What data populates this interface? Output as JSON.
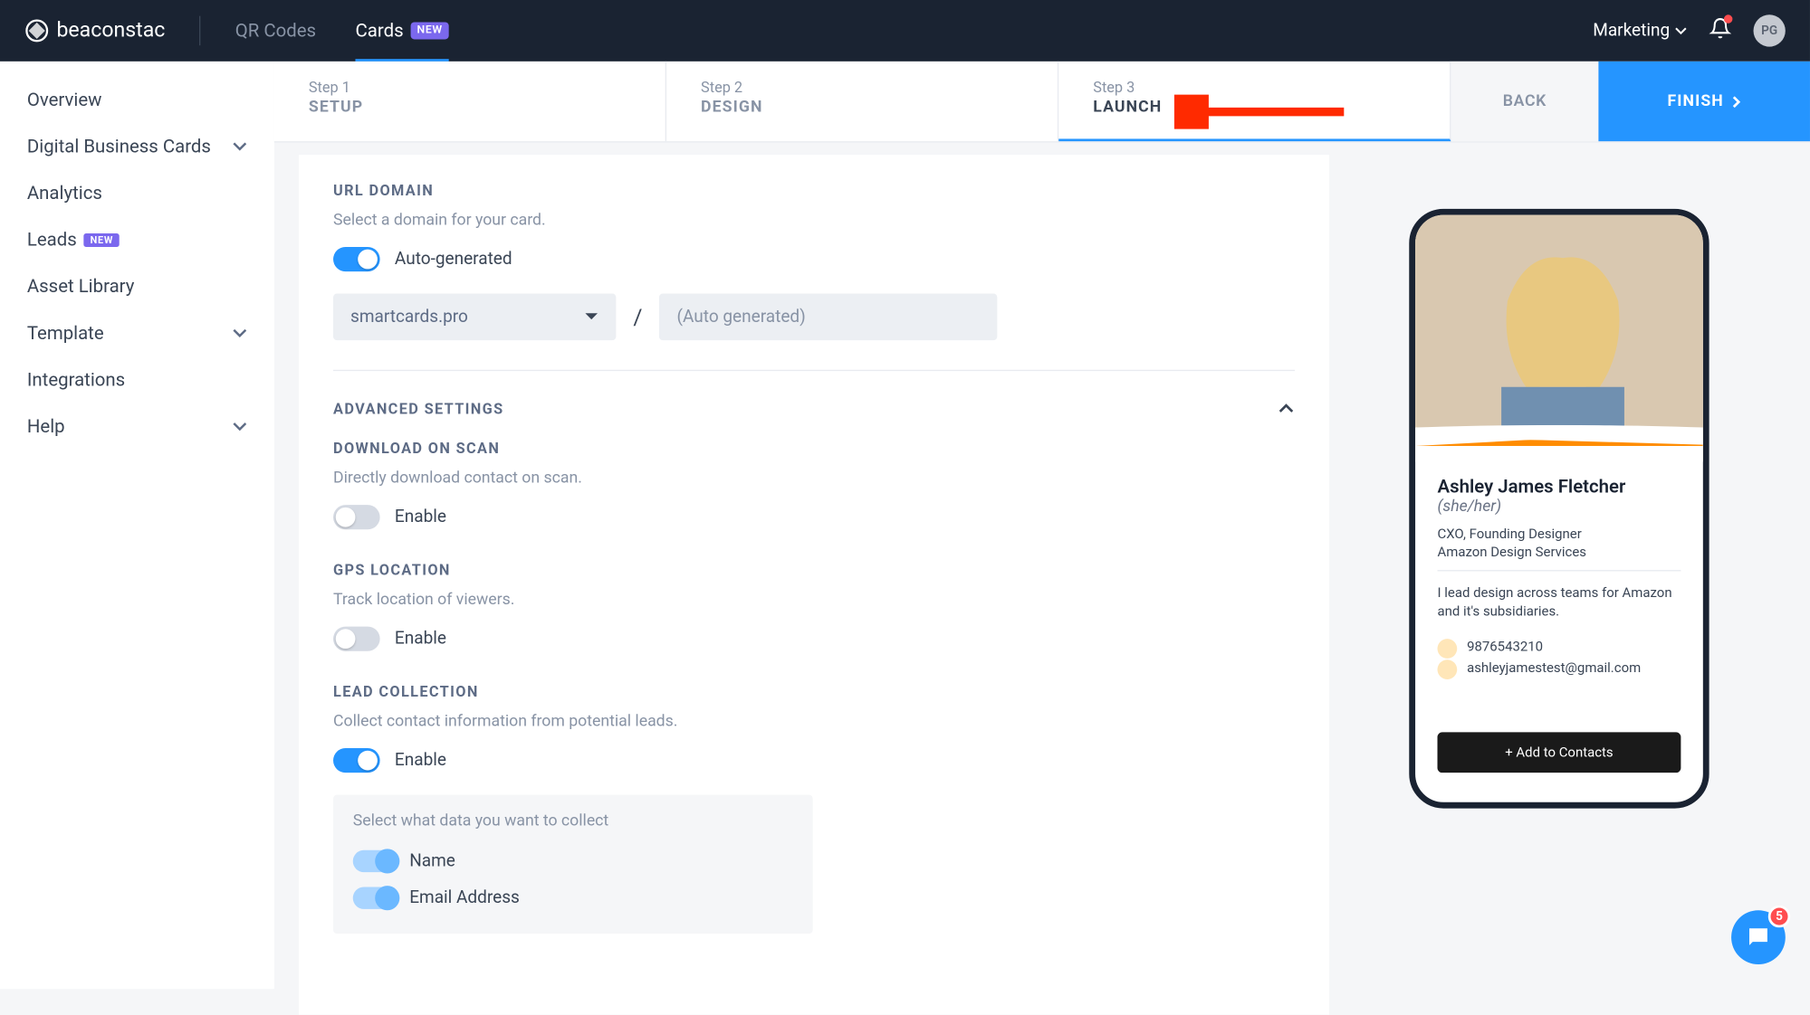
{
  "topnav": {
    "brand": "beaconstac",
    "links": [
      {
        "label": "QR Codes",
        "active": false
      },
      {
        "label": "Cards",
        "active": true,
        "badge": "NEW"
      }
    ],
    "workspace": "Marketing",
    "avatar": "PG"
  },
  "sidebar": {
    "items": [
      {
        "label": "Overview"
      },
      {
        "label": "Digital Business Cards",
        "expandable": true
      },
      {
        "label": "Analytics"
      },
      {
        "label": "Leads",
        "badge": "NEW"
      },
      {
        "label": "Asset Library"
      },
      {
        "label": "Template",
        "expandable": true
      },
      {
        "label": "Integrations"
      },
      {
        "label": "Help",
        "expandable": true
      }
    ]
  },
  "steps": {
    "list": [
      {
        "num": "Step 1",
        "name": "SETUP"
      },
      {
        "num": "Step 2",
        "name": "DESIGN"
      },
      {
        "num": "Step 3",
        "name": "LAUNCH"
      }
    ],
    "back": "BACK",
    "finish": "FINISH"
  },
  "url_domain": {
    "title": "URL DOMAIN",
    "desc": "Select a domain for your card.",
    "toggle_label": "Auto-generated",
    "domain": "smartcards.pro",
    "slash": "/",
    "placeholder": "(Auto generated)"
  },
  "advanced": {
    "title": "ADVANCED SETTINGS",
    "download": {
      "title": "DOWNLOAD ON SCAN",
      "desc": "Directly download contact on scan.",
      "label": "Enable"
    },
    "gps": {
      "title": "GPS LOCATION",
      "desc": "Track location of viewers.",
      "label": "Enable"
    },
    "lead": {
      "title": "LEAD COLLECTION",
      "desc": "Collect contact information from potential leads.",
      "label": "Enable",
      "box_title": "Select what data you want to collect",
      "items": [
        "Name",
        "Email Address"
      ]
    }
  },
  "preview": {
    "name": "Ashley James Fletcher",
    "pronoun": "(she/her)",
    "title": "CXO, Founding Designer",
    "company": "Amazon Design Services",
    "bio": "I lead design across teams for Amazon and it's subsidiaries.",
    "phone": "9876543210",
    "email": "ashleyjamestest@gmail.com",
    "button": "+ Add to Contacts"
  },
  "chat": {
    "count": "5"
  }
}
